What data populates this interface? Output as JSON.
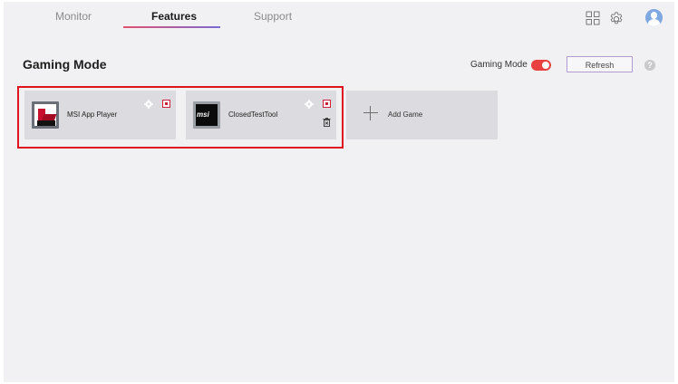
{
  "nav": {
    "tabs": [
      {
        "label": "Monitor",
        "active": false
      },
      {
        "label": "Features",
        "active": true
      },
      {
        "label": "Support",
        "active": false
      }
    ],
    "icons": [
      "grid-icon",
      "gear-icon",
      "avatar"
    ]
  },
  "header": {
    "title": "Gaming Mode",
    "gaming_mode_label": "Gaming Mode",
    "gaming_mode_on": true,
    "refresh_label": "Refresh",
    "help_label": "?"
  },
  "games": [
    {
      "name": "MSI App Player",
      "icon": "msi-app-player-icon",
      "deletable": false
    },
    {
      "name": "ClosedTestTool",
      "icon": "msi-logo-icon",
      "deletable": true,
      "logo_text": "msi"
    }
  ],
  "add_game": {
    "label": "Add Game"
  },
  "colors": {
    "accent_red": "#e8413f",
    "tab_gradient_start": "#e2506f",
    "tab_gradient_end": "#7a6bd4",
    "highlight_border": "#e0141e"
  }
}
